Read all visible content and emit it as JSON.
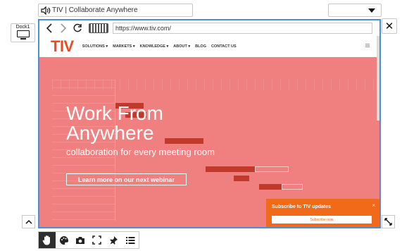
{
  "window": {
    "title": "TIV | Collaborate Anywhere"
  },
  "dock": {
    "label": "Dock1"
  },
  "browser": {
    "url": "https://www.tiv.com/"
  },
  "site": {
    "logo": "TIV",
    "menu": [
      "SOLUTIONS ▾",
      "MARKETS ▾",
      "KNOWLEDGE ▾",
      "ABOUT ▾",
      "BLOG",
      "CONTACT US"
    ]
  },
  "hero": {
    "title_line1": "Work From",
    "title_line2": "Anywhere",
    "subtitle": "collaboration for every meeting room",
    "cta": "Learn more on our next webinar"
  },
  "subscribe": {
    "title": "Subscribe to TIV updates",
    "button": "Subscribe now",
    "close": "×"
  },
  "colors": {
    "accent": "#4a90d9",
    "brand": "#e84c22",
    "hero": "#f08080",
    "popup": "#f06a1a"
  },
  "toolbar": {
    "icons": [
      "hand-icon",
      "palette-icon",
      "camera-icon",
      "fullscreen-icon",
      "pin-icon",
      "list-icon"
    ],
    "active": "hand-icon"
  }
}
